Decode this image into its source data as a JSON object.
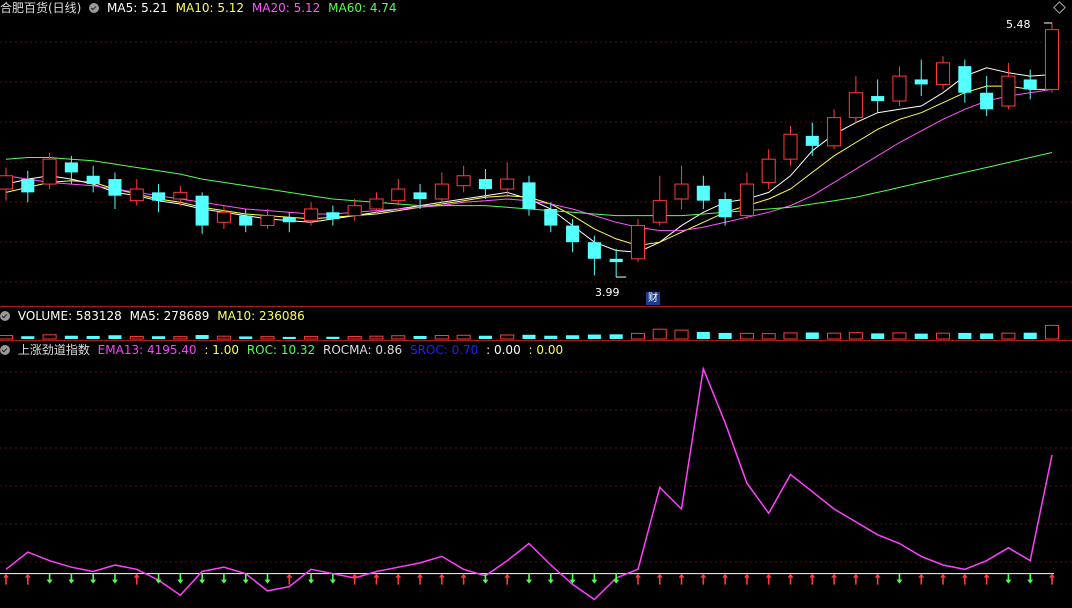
{
  "price_header": {
    "title": "合肥百货(日线)",
    "ma5": "MA5: 5.21",
    "ma10": "MA10: 5.12",
    "ma20": "MA20: 5.12",
    "ma60": "MA60: 4.74"
  },
  "volume_header": {
    "volume": "VOLUME: 583128",
    "ma5": "MA5: 278689",
    "ma10": "MA10: 236086"
  },
  "indicator_header": {
    "title": "上涨劲道指数",
    "ema13": "EMA13: 4195.40",
    "v1": ": 1.00",
    "roc": "ROC: 10.32",
    "rocma": "ROCMA: 0.86",
    "sroc": "SROC: 0.70",
    "v2": ": 0.00",
    "v3": ": 0.00"
  },
  "annotations": {
    "high_label": "5.48",
    "low_label": "3.99",
    "finance_badge": "财"
  },
  "colors": {
    "up": "#ff3c3c",
    "down": "#54ffff",
    "ma5": "#ffffff",
    "ma10": "#ffff54",
    "ma20": "#ff54ff",
    "ma60": "#54ff54",
    "ema13": "#ff40ff",
    "separator": "#b01818"
  },
  "chart_data": [
    {
      "type": "line",
      "name": "price",
      "title": "合肥百货(日线)",
      "y_range": [
        3.9,
        5.55
      ],
      "series": [
        {
          "name": "MA5",
          "values": [
            4.55,
            4.58,
            4.6,
            4.58,
            4.55,
            4.5,
            4.48,
            4.45,
            4.43,
            4.4,
            4.38,
            4.36,
            4.34,
            4.33,
            4.32,
            4.34,
            4.36,
            4.38,
            4.4,
            4.42,
            4.44,
            4.46,
            4.48,
            4.5,
            4.46,
            4.4,
            4.3,
            4.2,
            4.15,
            4.14,
            4.2,
            4.3,
            4.38,
            4.44,
            4.46,
            4.5,
            4.6,
            4.75,
            4.85,
            4.92,
            4.98,
            5.0,
            5.02,
            5.1,
            5.2,
            5.25,
            5.22,
            5.2,
            5.21
          ]
        },
        {
          "name": "MA10",
          "values": [
            4.5,
            4.53,
            4.56,
            4.57,
            4.56,
            4.52,
            4.49,
            4.46,
            4.44,
            4.41,
            4.39,
            4.37,
            4.36,
            4.35,
            4.34,
            4.35,
            4.36,
            4.37,
            4.39,
            4.41,
            4.43,
            4.45,
            4.47,
            4.48,
            4.47,
            4.43,
            4.36,
            4.28,
            4.22,
            4.18,
            4.2,
            4.26,
            4.32,
            4.38,
            4.42,
            4.46,
            4.52,
            4.62,
            4.72,
            4.8,
            4.88,
            4.94,
            4.98,
            5.04,
            5.1,
            5.14,
            5.14,
            5.12,
            5.12
          ]
        },
        {
          "name": "MA20",
          "values": [
            4.6,
            4.58,
            4.56,
            4.55,
            4.54,
            4.52,
            4.5,
            4.48,
            4.46,
            4.44,
            4.42,
            4.4,
            4.39,
            4.38,
            4.37,
            4.37,
            4.38,
            4.39,
            4.4,
            4.41,
            4.42,
            4.44,
            4.45,
            4.46,
            4.45,
            4.43,
            4.4,
            4.36,
            4.32,
            4.29,
            4.27,
            4.27,
            4.29,
            4.32,
            4.35,
            4.38,
            4.42,
            4.48,
            4.56,
            4.64,
            4.72,
            4.8,
            4.87,
            4.94,
            5.0,
            5.05,
            5.08,
            5.1,
            5.12
          ]
        },
        {
          "name": "MA60",
          "values": [
            4.7,
            4.71,
            4.71,
            4.7,
            4.69,
            4.67,
            4.65,
            4.63,
            4.61,
            4.58,
            4.56,
            4.54,
            4.52,
            4.5,
            4.48,
            4.46,
            4.45,
            4.44,
            4.43,
            4.42,
            4.42,
            4.42,
            4.42,
            4.41,
            4.4,
            4.39,
            4.38,
            4.37,
            4.36,
            4.36,
            4.36,
            4.36,
            4.37,
            4.38,
            4.39,
            4.4,
            4.41,
            4.43,
            4.45,
            4.47,
            4.5,
            4.53,
            4.56,
            4.59,
            4.62,
            4.65,
            4.68,
            4.71,
            4.74
          ]
        }
      ],
      "candles": [
        [
          4.52,
          4.6,
          4.45,
          4.65
        ],
        [
          4.58,
          4.5,
          4.44,
          4.63
        ],
        [
          4.55,
          4.7,
          4.52,
          4.74
        ],
        [
          4.68,
          4.62,
          4.55,
          4.72
        ],
        [
          4.6,
          4.55,
          4.5,
          4.66
        ],
        [
          4.58,
          4.48,
          4.4,
          4.62
        ],
        [
          4.45,
          4.52,
          4.42,
          4.58
        ],
        [
          4.5,
          4.45,
          4.38,
          4.55
        ],
        [
          4.46,
          4.5,
          4.42,
          4.54
        ],
        [
          4.48,
          4.3,
          4.25,
          4.5
        ],
        [
          4.32,
          4.38,
          4.28,
          4.42
        ],
        [
          4.36,
          4.3,
          4.26,
          4.4
        ],
        [
          4.3,
          4.36,
          4.28,
          4.4
        ],
        [
          4.35,
          4.32,
          4.26,
          4.38
        ],
        [
          4.33,
          4.4,
          4.3,
          4.44
        ],
        [
          4.38,
          4.34,
          4.3,
          4.42
        ],
        [
          4.36,
          4.42,
          4.33,
          4.46
        ],
        [
          4.4,
          4.46,
          4.38,
          4.5
        ],
        [
          4.45,
          4.52,
          4.42,
          4.58
        ],
        [
          4.5,
          4.46,
          4.4,
          4.55
        ],
        [
          4.46,
          4.55,
          4.44,
          4.62
        ],
        [
          4.54,
          4.6,
          4.5,
          4.66
        ],
        [
          4.58,
          4.52,
          4.46,
          4.64
        ],
        [
          4.52,
          4.58,
          4.48,
          4.68
        ],
        [
          4.56,
          4.4,
          4.36,
          4.6
        ],
        [
          4.4,
          4.3,
          4.26,
          4.44
        ],
        [
          4.3,
          4.2,
          4.14,
          4.34
        ],
        [
          4.2,
          4.1,
          4.0,
          4.24
        ],
        [
          4.1,
          4.08,
          3.99,
          4.16
        ],
        [
          4.1,
          4.3,
          4.08,
          4.34
        ],
        [
          4.32,
          4.45,
          4.3,
          4.6
        ],
        [
          4.46,
          4.55,
          4.4,
          4.66
        ],
        [
          4.54,
          4.45,
          4.4,
          4.6
        ],
        [
          4.46,
          4.35,
          4.3,
          4.5
        ],
        [
          4.36,
          4.55,
          4.34,
          4.62
        ],
        [
          4.56,
          4.7,
          4.52,
          4.76
        ],
        [
          4.7,
          4.85,
          4.66,
          4.9
        ],
        [
          4.84,
          4.78,
          4.72,
          4.92
        ],
        [
          4.78,
          4.95,
          4.76,
          5.0
        ],
        [
          4.95,
          5.1,
          4.92,
          5.2
        ],
        [
          5.08,
          5.05,
          4.98,
          5.18
        ],
        [
          5.05,
          5.2,
          5.02,
          5.26
        ],
        [
          5.18,
          5.15,
          5.08,
          5.3
        ],
        [
          5.15,
          5.28,
          5.12,
          5.32
        ],
        [
          5.26,
          5.1,
          5.04,
          5.3
        ],
        [
          5.1,
          5.0,
          4.96,
          5.2
        ],
        [
          5.02,
          5.2,
          5.0,
          5.28
        ],
        [
          5.18,
          5.12,
          5.06,
          5.24
        ],
        [
          5.12,
          5.48,
          5.1,
          5.52
        ]
      ]
    },
    {
      "type": "bar",
      "name": "volume",
      "title": "VOLUME",
      "y_range": [
        0,
        600000
      ],
      "series": [
        {
          "name": "VOLUME",
          "values": [
            150000,
            120000,
            180000,
            140000,
            130000,
            160000,
            110000,
            120000,
            100000,
            170000,
            120000,
            110000,
            100000,
            90000,
            110000,
            95000,
            105000,
            120000,
            140000,
            130000,
            150000,
            160000,
            140000,
            170000,
            180000,
            140000,
            160000,
            190000,
            200000,
            240000,
            420000,
            380000,
            300000,
            260000,
            240000,
            230000,
            260000,
            280000,
            250000,
            270000,
            240000,
            260000,
            230000,
            250000,
            260000,
            240000,
            250000,
            270000,
            583128
          ]
        }
      ]
    },
    {
      "type": "line",
      "name": "indicator",
      "title": "上涨劲道指数",
      "y_range": [
        -0.15,
        1.0
      ],
      "series": [
        {
          "name": "EMA13",
          "values": [
            0.02,
            0.1,
            0.06,
            0.03,
            0.01,
            0.04,
            0.02,
            -0.03,
            -0.1,
            0.01,
            0.03,
            0.0,
            -0.08,
            -0.06,
            0.02,
            0.0,
            -0.02,
            0.01,
            0.03,
            0.05,
            0.08,
            0.02,
            -0.01,
            0.06,
            0.14,
            0.04,
            -0.05,
            -0.12,
            -0.02,
            0.02,
            0.4,
            0.3,
            0.95,
            0.7,
            0.42,
            0.28,
            0.46,
            0.38,
            0.3,
            0.24,
            0.18,
            0.14,
            0.08,
            0.04,
            0.02,
            0.06,
            0.12,
            0.06,
            0.55
          ]
        },
        {
          "name": "ROC",
          "values": [
            0,
            0,
            0,
            0,
            0,
            0,
            0,
            0,
            0,
            0,
            0,
            0,
            0,
            0,
            0,
            0,
            0,
            0,
            0,
            0,
            0,
            0,
            0,
            0,
            0,
            0,
            0,
            0,
            0,
            0,
            0,
            0,
            0,
            0,
            0,
            0,
            0,
            0,
            0,
            0,
            0,
            0,
            0,
            0,
            0,
            0,
            0,
            0,
            0
          ]
        }
      ],
      "signals": [
        "up",
        "up",
        "down",
        "down",
        "down",
        "down",
        "up",
        "down",
        "down",
        "down",
        "down",
        "down",
        "down",
        "up",
        "down",
        "down",
        "up",
        "up",
        "up",
        "up",
        "up",
        "up",
        "down",
        "up",
        "down",
        "down",
        "down",
        "down",
        "down",
        "up",
        "up",
        "up",
        "up",
        "up",
        "up",
        "up",
        "up",
        "up",
        "up",
        "up",
        "up",
        "down",
        "up",
        "up",
        "up",
        "up",
        "down",
        "down",
        "up"
      ]
    }
  ]
}
